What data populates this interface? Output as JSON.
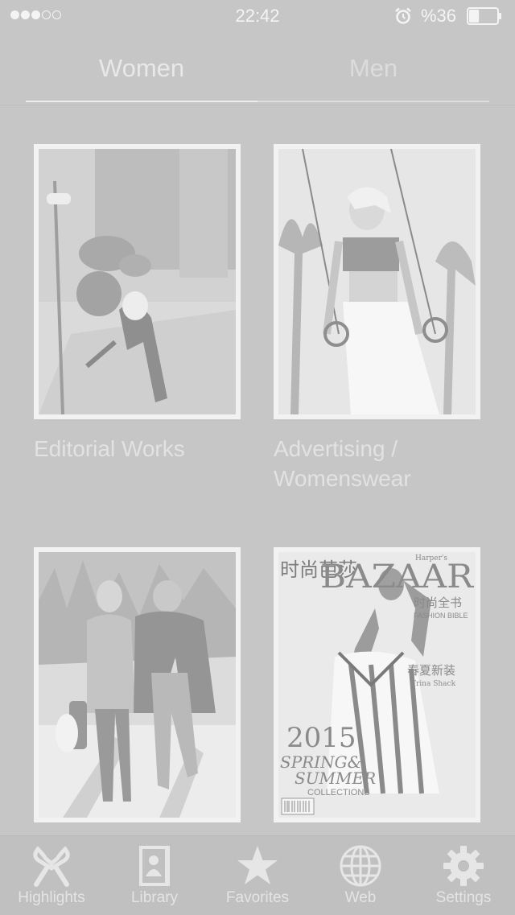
{
  "status_bar": {
    "time": "22:42",
    "battery_percent": "%36",
    "signal_bars_filled": 3,
    "signal_bars_total": 5,
    "battery_level": 0.36,
    "icons": [
      "signal-dots-icon",
      "alarm-icon",
      "battery-icon"
    ]
  },
  "segments": {
    "women": "Women",
    "men": "Men",
    "active": "women"
  },
  "cards": [
    {
      "title": "Editorial Works"
    },
    {
      "title": "Advertising / Womenswear"
    },
    {
      "title": ""
    },
    {
      "title": ""
    }
  ],
  "magazine_cover": {
    "brand_cn": "时尚芭莎",
    "brand_latin": "BAZAAR",
    "publisher": "Harper's",
    "subtitle_cn": "时尚全书",
    "subtitle_en": "FASHION BIBLE",
    "headline_cn": "春夏新装",
    "byline": "Trina Shack",
    "year": "2015",
    "season_1": "SPRING&",
    "season_2": "SUMMER",
    "collections": "COLLECTIONS"
  },
  "tab_bar": {
    "tabs": [
      {
        "label": "Highlights",
        "icon": "scissors-icon"
      },
      {
        "label": "Library",
        "icon": "contact-book-icon"
      },
      {
        "label": "Favorites",
        "icon": "star-icon"
      },
      {
        "label": "Web",
        "icon": "globe-icon"
      },
      {
        "label": "Settings",
        "icon": "gear-icon"
      }
    ]
  },
  "colors": {
    "background": "#c6c6c6",
    "text_light": "#e9e9e9",
    "tab_bar": "#c0c0c0"
  }
}
